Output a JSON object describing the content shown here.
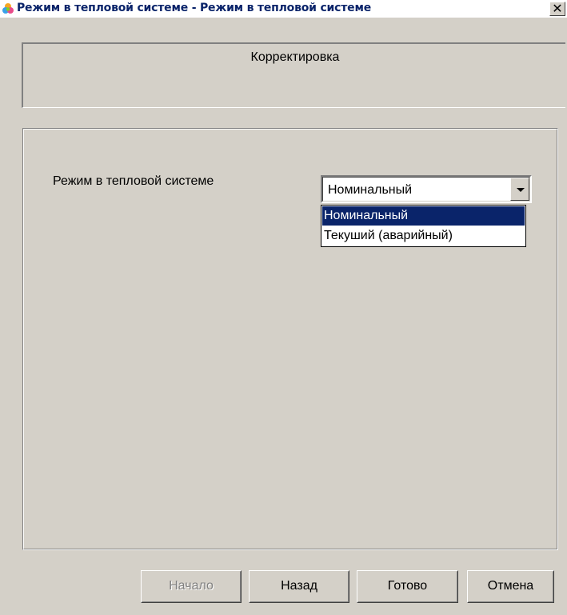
{
  "window": {
    "title": "Режим в тепловой системе - Режим в тепловой системе",
    "close_glyph": "✕"
  },
  "header": {
    "title": "Корректировка"
  },
  "form": {
    "label": "Режим в тепловой системе",
    "combo": {
      "selected_value": "Номинальный",
      "options": [
        "Номинальный",
        "Текуший (аварийный)"
      ],
      "highlighted_index": 0
    }
  },
  "buttons": {
    "start": "Начало",
    "back": "Назад",
    "finish": "Готово",
    "cancel": "Отмена"
  },
  "colors": {
    "title_text": "#0a246a",
    "selection": "#0a246a",
    "face": "#d4d0c8"
  }
}
